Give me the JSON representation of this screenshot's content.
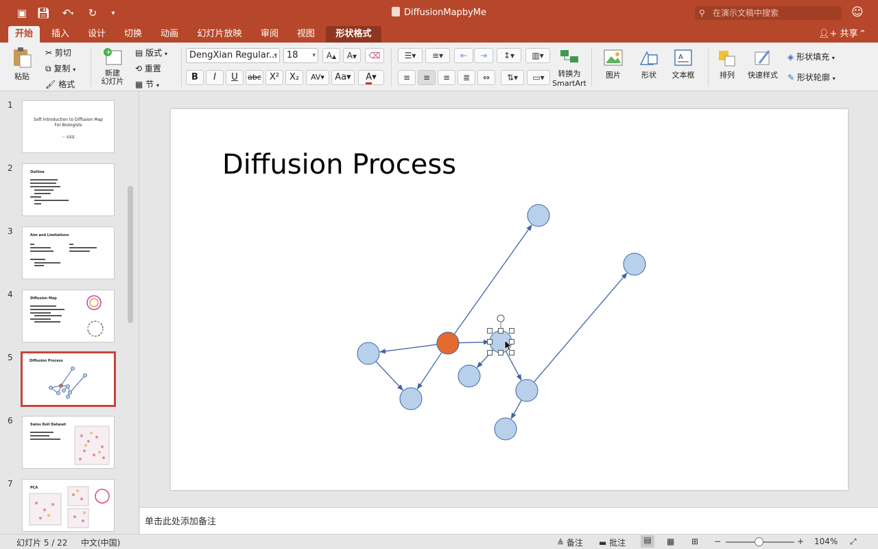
{
  "window": {
    "title": "DiffusionMapbyMe",
    "search_placeholder": "在演示文稿中搜索",
    "share_label": "共享"
  },
  "tabs": [
    {
      "label": "开始",
      "active": true
    },
    {
      "label": "插入"
    },
    {
      "label": "设计"
    },
    {
      "label": "切换"
    },
    {
      "label": "动画"
    },
    {
      "label": "幻灯片放映"
    },
    {
      "label": "审阅"
    },
    {
      "label": "视图"
    },
    {
      "label": "形状格式",
      "contextual": true
    }
  ],
  "ribbon": {
    "paste": "粘贴",
    "cut": "剪切",
    "copy": "复制",
    "format_painter": "格式",
    "new_slide": "新建\n幻灯片",
    "layout": "版式",
    "reset": "重置",
    "section": "节",
    "font_name": "DengXian Regular...",
    "font_size": "18",
    "convert_smartart_1": "转换为",
    "convert_smartart_2": "SmartArt",
    "picture": "图片",
    "shape": "形状",
    "textbox": "文本框",
    "arrange": "排列",
    "quick_styles": "快速样式",
    "shape_fill": "形状填充",
    "shape_outline": "形状轮廓",
    "font_color": "#d8302f"
  },
  "slides": [
    {
      "num": "1",
      "title": "Soft Introduction to Diffusion Map\nFor Biologists",
      "subtitle": "—·  吴某某"
    },
    {
      "num": "2",
      "title": "Outline"
    },
    {
      "num": "3",
      "title": "Aim and Limitations"
    },
    {
      "num": "4",
      "title": "Diffusion Map"
    },
    {
      "num": "5",
      "title": "Diffusion Process",
      "selected": true
    },
    {
      "num": "6",
      "title": "Swiss Roll Dataset"
    },
    {
      "num": "7",
      "title": "PCA"
    }
  ],
  "current_slide": {
    "title": "Diffusion Process",
    "node_fill": "#b8d0ea",
    "node_stroke": "#3d64a8",
    "highlight_fill": "#e56a2e",
    "edge_color": "#3d64a8",
    "graph": {
      "nodes": [
        {
          "id": "origin",
          "highlight": true
        },
        {
          "id": "top"
        },
        {
          "id": "left"
        },
        {
          "id": "bottom-left"
        },
        {
          "id": "selected",
          "selected": true
        },
        {
          "id": "mid"
        },
        {
          "id": "right-center"
        },
        {
          "id": "far-right"
        },
        {
          "id": "bottom"
        }
      ],
      "edges": [
        [
          "origin",
          "top"
        ],
        [
          "origin",
          "left"
        ],
        [
          "origin",
          "bottom-left"
        ],
        [
          "left",
          "bottom-left"
        ],
        [
          "origin",
          "selected"
        ],
        [
          "selected",
          "mid"
        ],
        [
          "selected",
          "right-center"
        ],
        [
          "right-center",
          "far-right"
        ],
        [
          "right-center",
          "bottom"
        ]
      ]
    }
  },
  "notes_placeholder": "单击此处添加备注",
  "status": {
    "slide_counter": "幻灯片 5 / 22",
    "language": "中文(中国)",
    "notes_label": "备注",
    "comments_label": "批注",
    "zoom": "104%"
  }
}
